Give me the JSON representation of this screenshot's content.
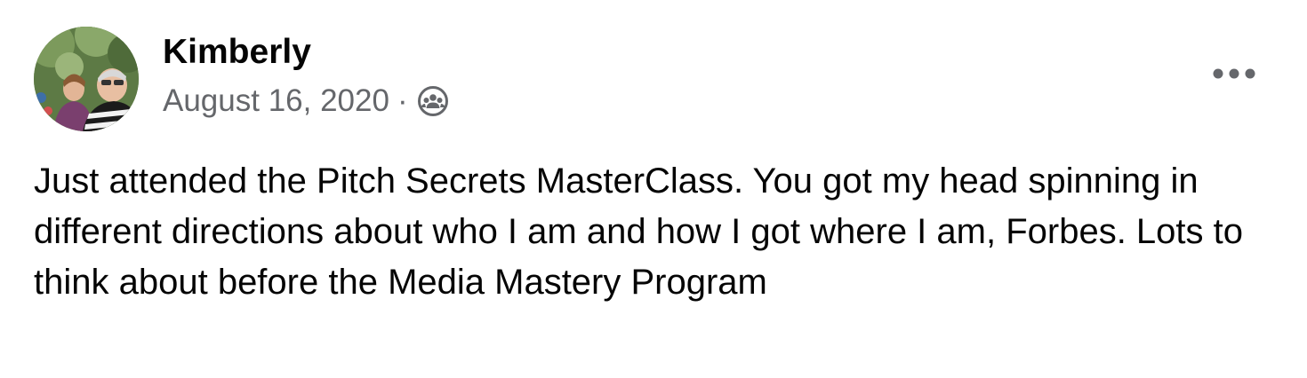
{
  "post": {
    "author": {
      "name": "Kimberly",
      "avatar": "profile-photo"
    },
    "timestamp": "August 16, 2020",
    "separator": "·",
    "audience_icon": "friends-icon",
    "more_icon": "more-options-icon",
    "text": "Just attended the Pitch Secrets MasterClass. You got my head spinning in different directions about who I am and how I got where I am, Forbes. Lots to think about before the Media Mastery Program"
  },
  "colors": {
    "primary_text": "#050505",
    "secondary_text": "#65676b",
    "background": "#ffffff"
  }
}
